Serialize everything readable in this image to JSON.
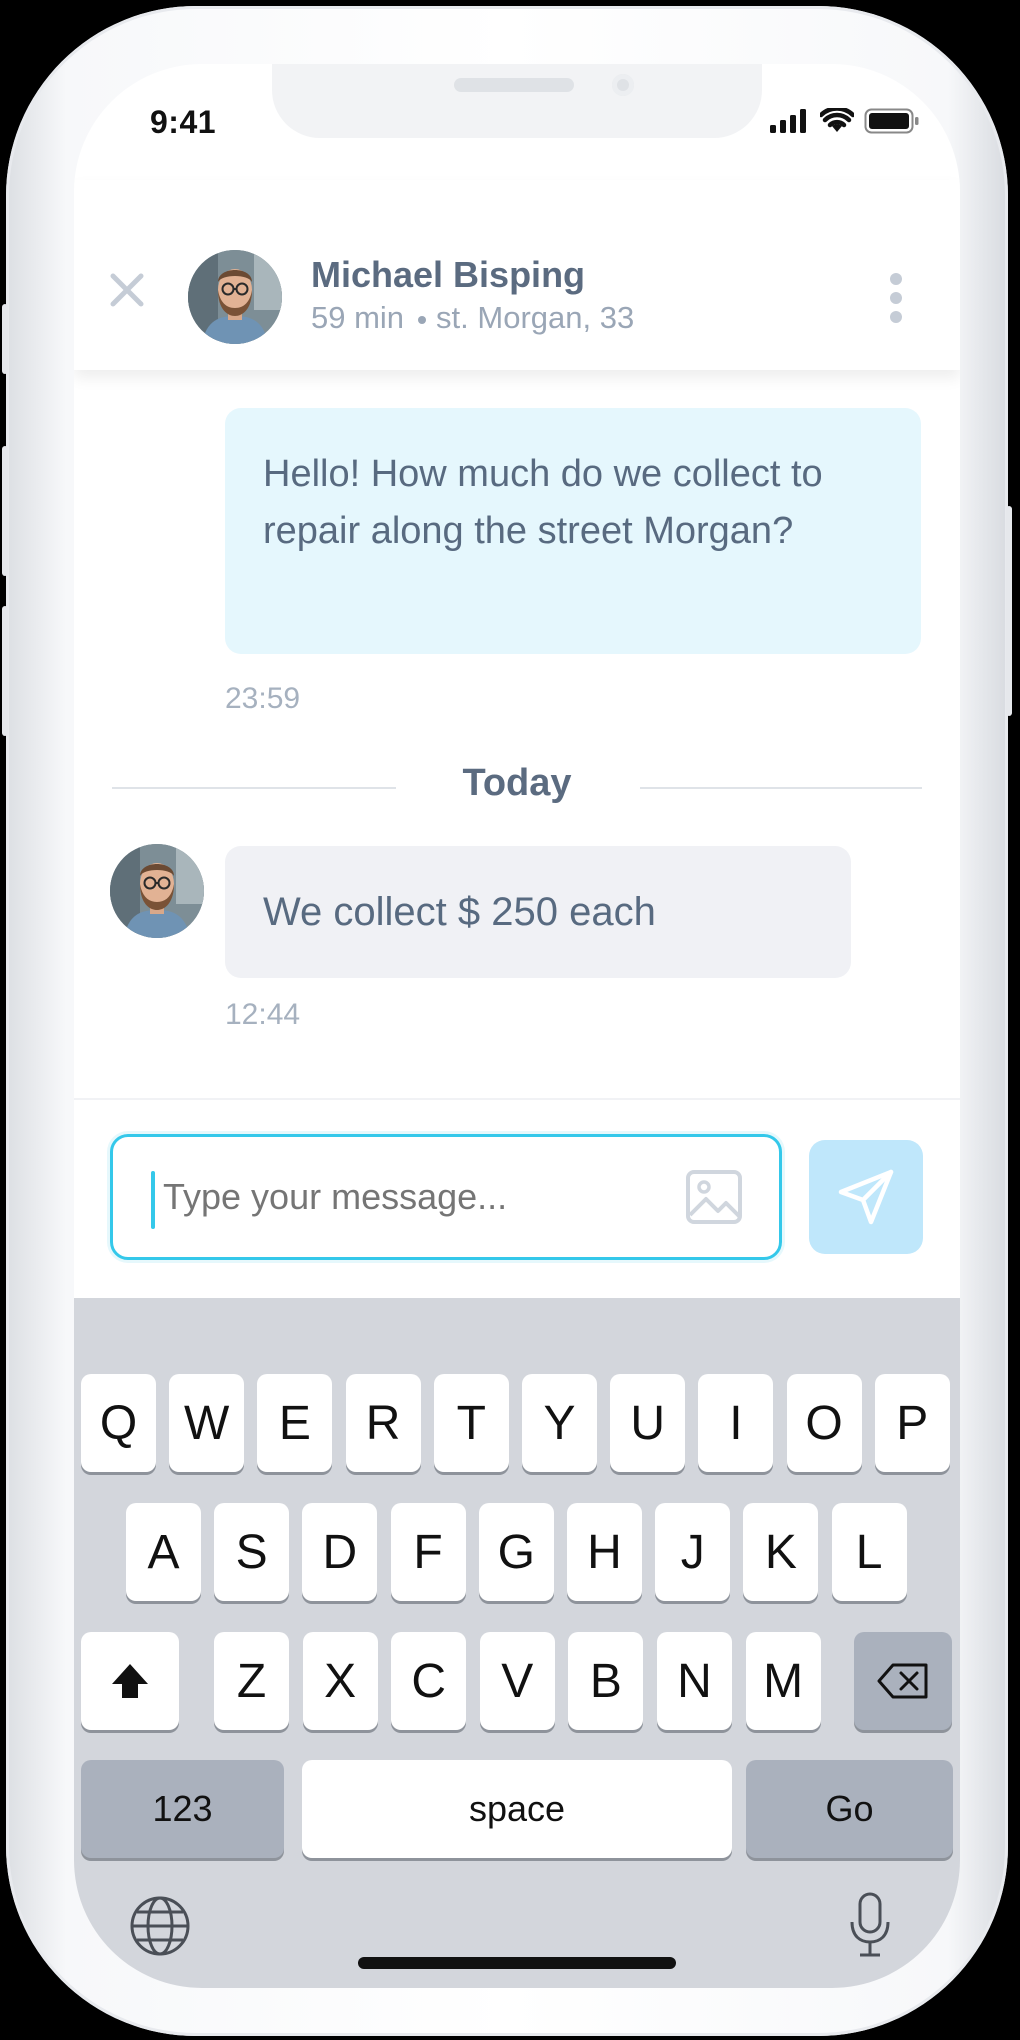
{
  "status_bar": {
    "time": "9:41"
  },
  "header": {
    "contact_name": "Michael Bisping",
    "time_ago": "59 min",
    "address": "st. Morgan, 33"
  },
  "messages": [
    {
      "direction": "outgoing",
      "text": "Hello! How much do we collect to repair along the street Morgan?",
      "time": "23:59"
    },
    {
      "direction": "incoming",
      "text": "We collect $ 250 each",
      "time": "12:44"
    }
  ],
  "separator": {
    "label": "Today"
  },
  "composer": {
    "placeholder": "Type your message..."
  },
  "keyboard": {
    "row1": [
      "Q",
      "W",
      "E",
      "R",
      "T",
      "Y",
      "U",
      "I",
      "O",
      "P"
    ],
    "row2": [
      "A",
      "S",
      "D",
      "F",
      "G",
      "H",
      "J",
      "K",
      "L"
    ],
    "row3": [
      "Z",
      "X",
      "C",
      "V",
      "B",
      "N",
      "M"
    ],
    "numbers_label": "123",
    "space_label": "space",
    "go_label": "Go"
  },
  "colors": {
    "accent": "#34c8ea",
    "outgoing_bubble": "#e5f7fd",
    "incoming_bubble": "#f0f1f5",
    "send_button": "#bfe7fb",
    "text_primary": "#586a80",
    "text_muted": "#a6b1bf",
    "keyboard_bg": "#d3d6dc"
  },
  "icons": [
    "close-icon",
    "menu-dots-icon",
    "image-icon",
    "send-icon",
    "shift-icon",
    "backspace-icon",
    "globe-icon",
    "microphone-icon",
    "signal-icon",
    "wifi-icon",
    "battery-icon"
  ]
}
